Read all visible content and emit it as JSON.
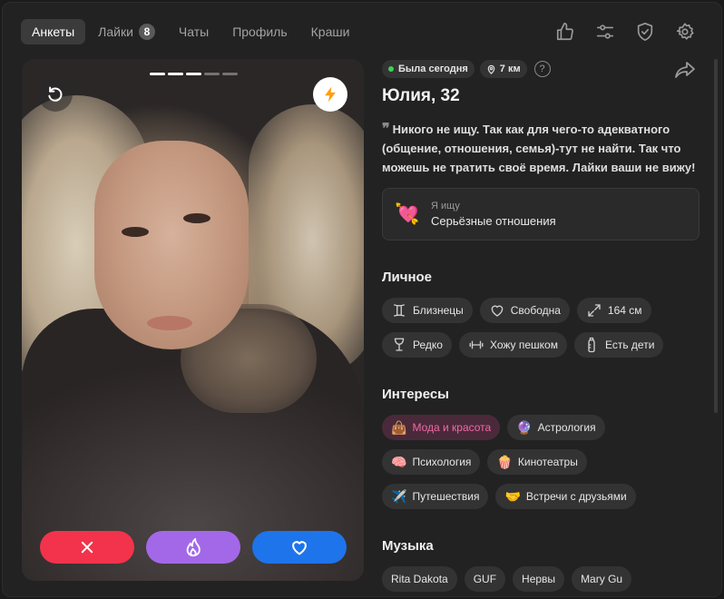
{
  "nav": {
    "tabs": [
      {
        "label": "Анкеты",
        "active": true
      },
      {
        "label": "Лайки",
        "badge": "8"
      },
      {
        "label": "Чаты"
      },
      {
        "label": "Профиль"
      },
      {
        "label": "Краши"
      }
    ],
    "icons": [
      "thumbs-up-icon",
      "sliders-icon",
      "shield-check-icon",
      "gear-icon"
    ]
  },
  "photo": {
    "progress_total": 5,
    "progress_current": 3
  },
  "profile": {
    "online": "Была сегодня",
    "distance": "7 км",
    "help": "?",
    "name": "Юлия, 32",
    "bio": "Никого не ищу. Так как для чего-то адекватного (общение, отношения, семья)-тут не найти. Так что можешь не тратить своё время. Лайки ваши не вижу!",
    "looking_label": "Я ищу",
    "looking_value": "Серьёзные отношения",
    "looking_emoji": "💘"
  },
  "personal": {
    "title": "Личное",
    "items": [
      {
        "label": "Близнецы",
        "icon": "gemini-icon"
      },
      {
        "label": "Свободна",
        "icon": "heart-outline-icon"
      },
      {
        "label": "164 см",
        "icon": "expand-icon"
      },
      {
        "label": "Редко",
        "icon": "wine-glass-icon"
      },
      {
        "label": "Хожу пешком",
        "icon": "dumbbell-icon"
      },
      {
        "label": "Есть дети",
        "icon": "baby-bottle-icon"
      }
    ]
  },
  "interests": {
    "title": "Интересы",
    "items": [
      {
        "label": "Мода и красота",
        "emoji": "👜",
        "highlight": true
      },
      {
        "label": "Астрология",
        "emoji": "🔮"
      },
      {
        "label": "Психология",
        "emoji": "🧠"
      },
      {
        "label": "Кинотеатры",
        "emoji": "🍿"
      },
      {
        "label": "Путешествия",
        "emoji": "✈️"
      },
      {
        "label": "Встречи с друзьями",
        "emoji": "🤝"
      }
    ]
  },
  "music": {
    "title": "Музыка",
    "items": [
      "Rita Dakota",
      "GUF",
      "Нервы",
      "Mary Gu"
    ]
  },
  "colors": {
    "dislike": "#f2334b",
    "super": "#a368e8",
    "like": "#1e74ea",
    "online": "#3fcf59",
    "highlight": "#f06aa6"
  }
}
